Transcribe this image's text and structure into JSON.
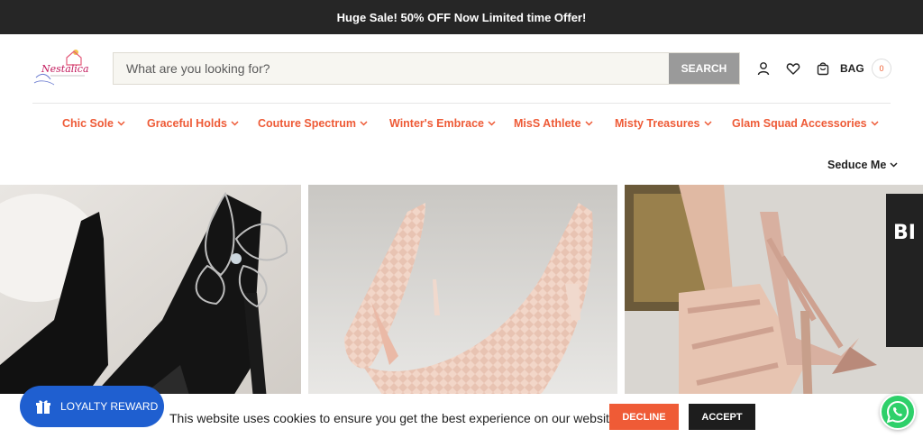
{
  "announcement": {
    "text": "Huge Sale! 50% OFF Now Limited time Offer!"
  },
  "logo": {
    "text": "Nestalica"
  },
  "search": {
    "placeholder": "What are you looking for?",
    "button_label": "SEARCH"
  },
  "header_icons": {
    "account": "user-icon",
    "wishlist": "heart-icon",
    "cart": "bag-icon"
  },
  "bag": {
    "label": "BAG",
    "count": "0"
  },
  "nav": {
    "items": [
      {
        "label": "Chic Sole"
      },
      {
        "label": "Graceful Holds"
      },
      {
        "label": "Couture Spectrum"
      },
      {
        "label": "Winter's Embrace"
      },
      {
        "label": "MisS Athlete"
      },
      {
        "label": "Misty Treasures"
      },
      {
        "label": "Glam Squad Accessories"
      },
      {
        "label": "Seduce Me"
      }
    ]
  },
  "hero": {
    "panels": [
      "black-butterfly-pump",
      "blush-woven-pump",
      "strappy-nude-sandal"
    ]
  },
  "cookie": {
    "text": "This website uses cookies to ensure you get the best experience on our website.",
    "decline_label": "DECLINE",
    "accept_label": "ACCEPT"
  },
  "loyalty": {
    "label": "LOYALTY REWARD"
  },
  "colors": {
    "accent": "#EE5A36",
    "dark": "#262626",
    "loyalty_blue": "#1F5FD0",
    "whatsapp_green": "#2ED06A"
  }
}
